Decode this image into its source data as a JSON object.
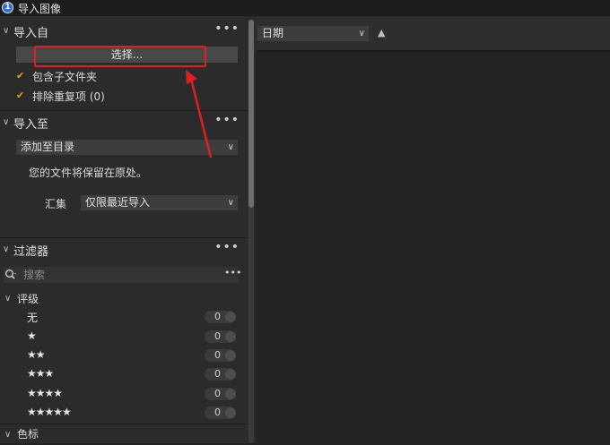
{
  "window": {
    "title": "导入图像",
    "app_icon_glyph": "1"
  },
  "import_from": {
    "header": "导入自",
    "more": "•••",
    "select_button": "选择...",
    "include_subfolders": {
      "label": "包含子文件夹",
      "checked": true
    },
    "exclude_duplicates": {
      "label": "排除重复项 (0)",
      "checked": true
    }
  },
  "import_to": {
    "header": "导入至",
    "more": "•••",
    "destination": "添加至目录",
    "note": "您的文件将保留在原处。",
    "collection_label": "汇集",
    "collection_value": "仅限最近导入"
  },
  "filters": {
    "header": "过滤器",
    "more": "•••",
    "search_placeholder": "搜索",
    "search_more": "•••",
    "rating_header": "评级",
    "ratings": [
      {
        "label": "无",
        "count": "0"
      },
      {
        "label": "★",
        "count": "0"
      },
      {
        "label": "★★",
        "count": "0"
      },
      {
        "label": "★★★",
        "count": "0"
      },
      {
        "label": "★★★★",
        "count": "0"
      },
      {
        "label": "★★★★★",
        "count": "0"
      }
    ],
    "color_label_header": "色标"
  },
  "toolbar": {
    "sort_value": "日期",
    "sort_direction": "▲"
  },
  "icons": {
    "chevron": "chevron-down-icon",
    "check": "checkmark-icon",
    "search": "search-icon"
  },
  "colors": {
    "highlight": "#e02020",
    "check": "#e59a1e",
    "app_icon": "#2f6fd6"
  }
}
